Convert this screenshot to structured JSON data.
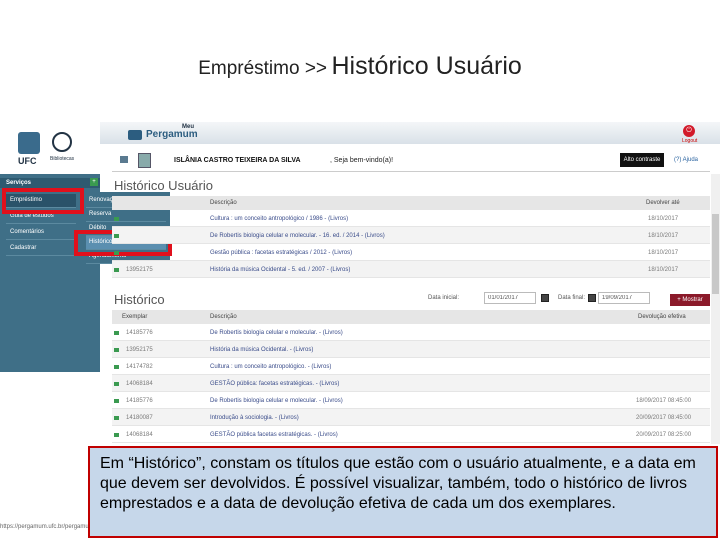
{
  "slide": {
    "title_small": "Empréstimo >>",
    "title_big": "Histórico Usuário"
  },
  "brand": {
    "ufc": "UFC",
    "library": "Bibliotecas",
    "meu": "Meu",
    "pergamum": "Pergamum",
    "logout": "Logout"
  },
  "sidebar": {
    "header": "Serviços",
    "collapse_icon": "+",
    "items": [
      {
        "label": "Empréstimo"
      },
      {
        "label": "Guia de estudos"
      },
      {
        "label": "Comentários"
      },
      {
        "label": "Cadastrar"
      }
    ],
    "submenu": [
      {
        "label": "Renovação"
      },
      {
        "label": "Reserva"
      },
      {
        "label": "Débito"
      },
      {
        "label": "Histórico Usuário"
      },
      {
        "label": "Agendamento"
      }
    ]
  },
  "userbar": {
    "name": "ISLÂNIA CASTRO TEIXEIRA DA SILVA",
    "welcome": ", Seja bem-vindo(a)!",
    "contrast": "Alto contraste",
    "help": "(?) Ajuda"
  },
  "historico_usuario": {
    "title": "Histórico Usuário",
    "headers": {
      "desc": "Descrição",
      "devolver": "Devolver até"
    },
    "rows": [
      {
        "num": "",
        "desc": "Cultura : um conceito antropológico / 1986 - (Livros)",
        "date": "18/10/2017"
      },
      {
        "num": "",
        "desc": "De Robertis biologia celular e molecular. - 16. ed. / 2014 - (Livros)",
        "date": "18/10/2017"
      },
      {
        "num": "",
        "desc": "Gestão pública : facetas estratégicas / 2012 - (Livros)",
        "date": "18/10/2017"
      },
      {
        "num": "13952175",
        "desc": "História da música Ocidental - 5. ed. / 2007 - (Livros)",
        "date": "18/10/2017"
      }
    ]
  },
  "historico": {
    "title": "Histórico",
    "date_start_label": "Data inicial:",
    "date_start": "01/01/2017",
    "date_end_label": "Data final:",
    "date_end": "19/09/2017",
    "show_button": "+ Mostrar",
    "headers": {
      "exemplar": "Exemplar",
      "desc": "Descrição",
      "devolucao": "Devolução efetiva"
    },
    "rows": [
      {
        "num": "14185776",
        "desc": "De Robertis biologia celular e molecular. - (Livros)",
        "date": ""
      },
      {
        "num": "13952175",
        "desc": "História da música Ocidental. - (Livros)",
        "date": ""
      },
      {
        "num": "14174782",
        "desc": "Cultura : um conceito antropológico. - (Livros)",
        "date": ""
      },
      {
        "num": "14068184",
        "desc": "GESTÃO pública: facetas estratégicas. - (Livros)",
        "date": ""
      },
      {
        "num": "14185776",
        "desc": "De Robertis biologia celular e molecular. - (Livros)",
        "date": "18/09/2017 08:45:00"
      },
      {
        "num": "14180087",
        "desc": "Introdução à sociologia. - (Livros)",
        "date": "20/09/2017 08:45:00"
      },
      {
        "num": "14068184",
        "desc": "GESTÃO pública facetas estratégicas. - (Livros)",
        "date": "20/09/2017 08:25:00"
      }
    ]
  },
  "status_url": "https://pergamum.ufc.br/pergamum",
  "callout": "Em “Histórico”, constam os títulos que estão com o usuário atualmente, e a data em que devem ser devolvidos. É possível visualizar, também, todo o histórico de livros emprestados e a data de devolução efetiva de cada um dos exemplares."
}
